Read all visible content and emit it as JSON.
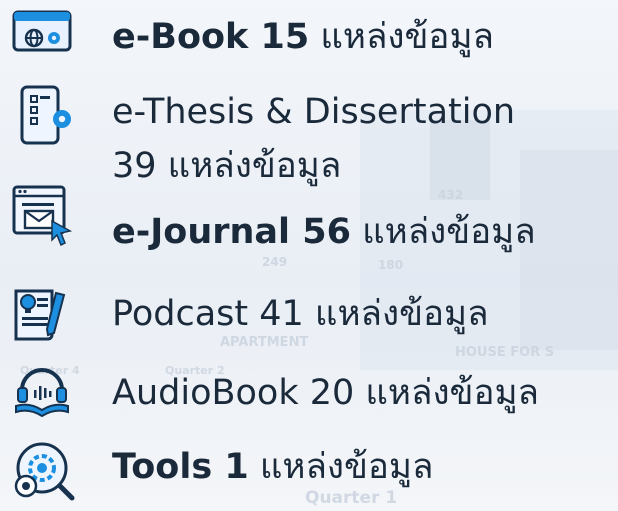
{
  "items": [
    {
      "icon": "web-settings-icon",
      "name": "e-Book  15",
      "suffix": " แหล่งข้อมูล",
      "bold": true
    },
    {
      "icon": "mobile-settings-icon",
      "name": "e-Thesis & Dissertation",
      "line2": "39 แหล่งข้อมูล",
      "bold": false
    },
    {
      "icon": "email-window-icon",
      "name": "e-Journal 56",
      "suffix": " แหล่งข้อมูล",
      "bold": true
    },
    {
      "icon": "idea-document-icon",
      "name": "Podcast 41 แหล่งข้อมูล",
      "bold": false
    },
    {
      "icon": "audiobook-icon",
      "name": "AudioBook 20 แหล่งข้อมูล",
      "bold": false
    },
    {
      "icon": "gear-search-icon",
      "name": "Tools  1",
      "suffix": " แหล่งข้อมูล",
      "bold": true
    }
  ],
  "background_text": [
    "432",
    "249",
    "180",
    "APARTMENT",
    "HOUSE FOR S",
    "Quarter 1",
    "Quarter 2",
    "Quarter 4"
  ]
}
